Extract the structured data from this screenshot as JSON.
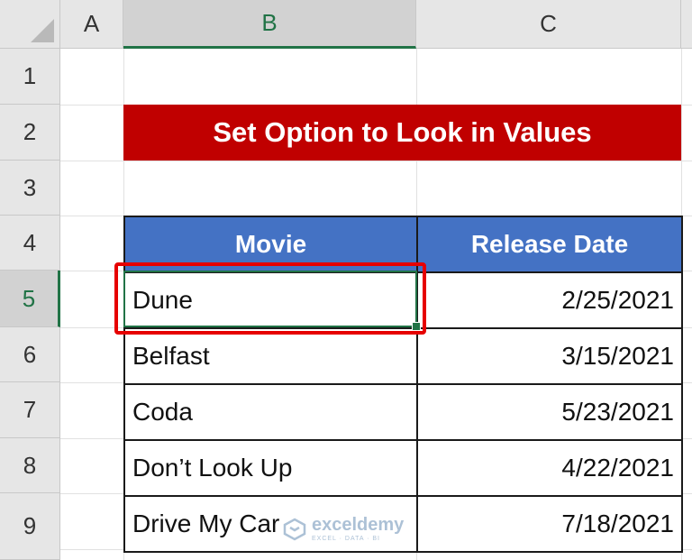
{
  "columns": [
    "A",
    "B",
    "C"
  ],
  "rows": [
    "1",
    "2",
    "3",
    "4",
    "5",
    "6",
    "7",
    "8",
    "9"
  ],
  "selected": {
    "column": "B",
    "row": "5"
  },
  "title": "Set Option to Look in Values",
  "table": {
    "headers": [
      "Movie",
      "Release Date"
    ],
    "rows": [
      [
        "Dune",
        "2/25/2021"
      ],
      [
        "Belfast",
        "3/15/2021"
      ],
      [
        "Coda",
        "5/23/2021"
      ],
      [
        "Don’t Look Up",
        "4/22/2021"
      ],
      [
        "Drive My Car",
        "7/18/2021"
      ]
    ]
  },
  "watermark": {
    "name": "exceldemy",
    "tagline": "EXCEL · DATA · BI"
  },
  "colors": {
    "title_bg": "#c00000",
    "header_bg": "#4472c4",
    "selection": "#217346",
    "highlight": "#e60000"
  }
}
